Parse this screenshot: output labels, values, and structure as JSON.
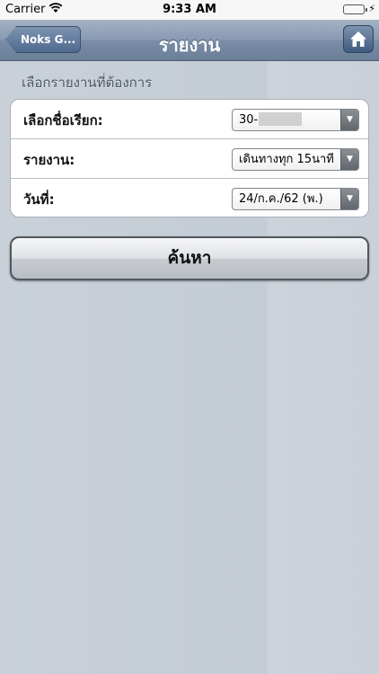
{
  "status_bar": {
    "carrier": "Carrier",
    "time": "9:33 AM",
    "wifi_icon": "wifi-icon",
    "battery_icon": "battery-icon",
    "charging_icon": "bolt-icon"
  },
  "navbar": {
    "back_label": "Noks G...",
    "title": "รายงาน",
    "home_icon": "home-icon"
  },
  "form": {
    "section_label": "เลือกรายงานที่ต้องการ",
    "rows": [
      {
        "label": "เลือกชื่อเรียก:",
        "value": "30-"
      },
      {
        "label": "รายงาน:",
        "value": "เดินทางทุก 15นาที"
      },
      {
        "label": "วันที่:",
        "value": "24/ก.ค./62 (พ.)"
      }
    ]
  },
  "search_button": {
    "label": "ค้นหา"
  },
  "colors": {
    "navbar": "#7a8ea8",
    "background": "#c9d0d8",
    "battery": "#4cd964"
  }
}
